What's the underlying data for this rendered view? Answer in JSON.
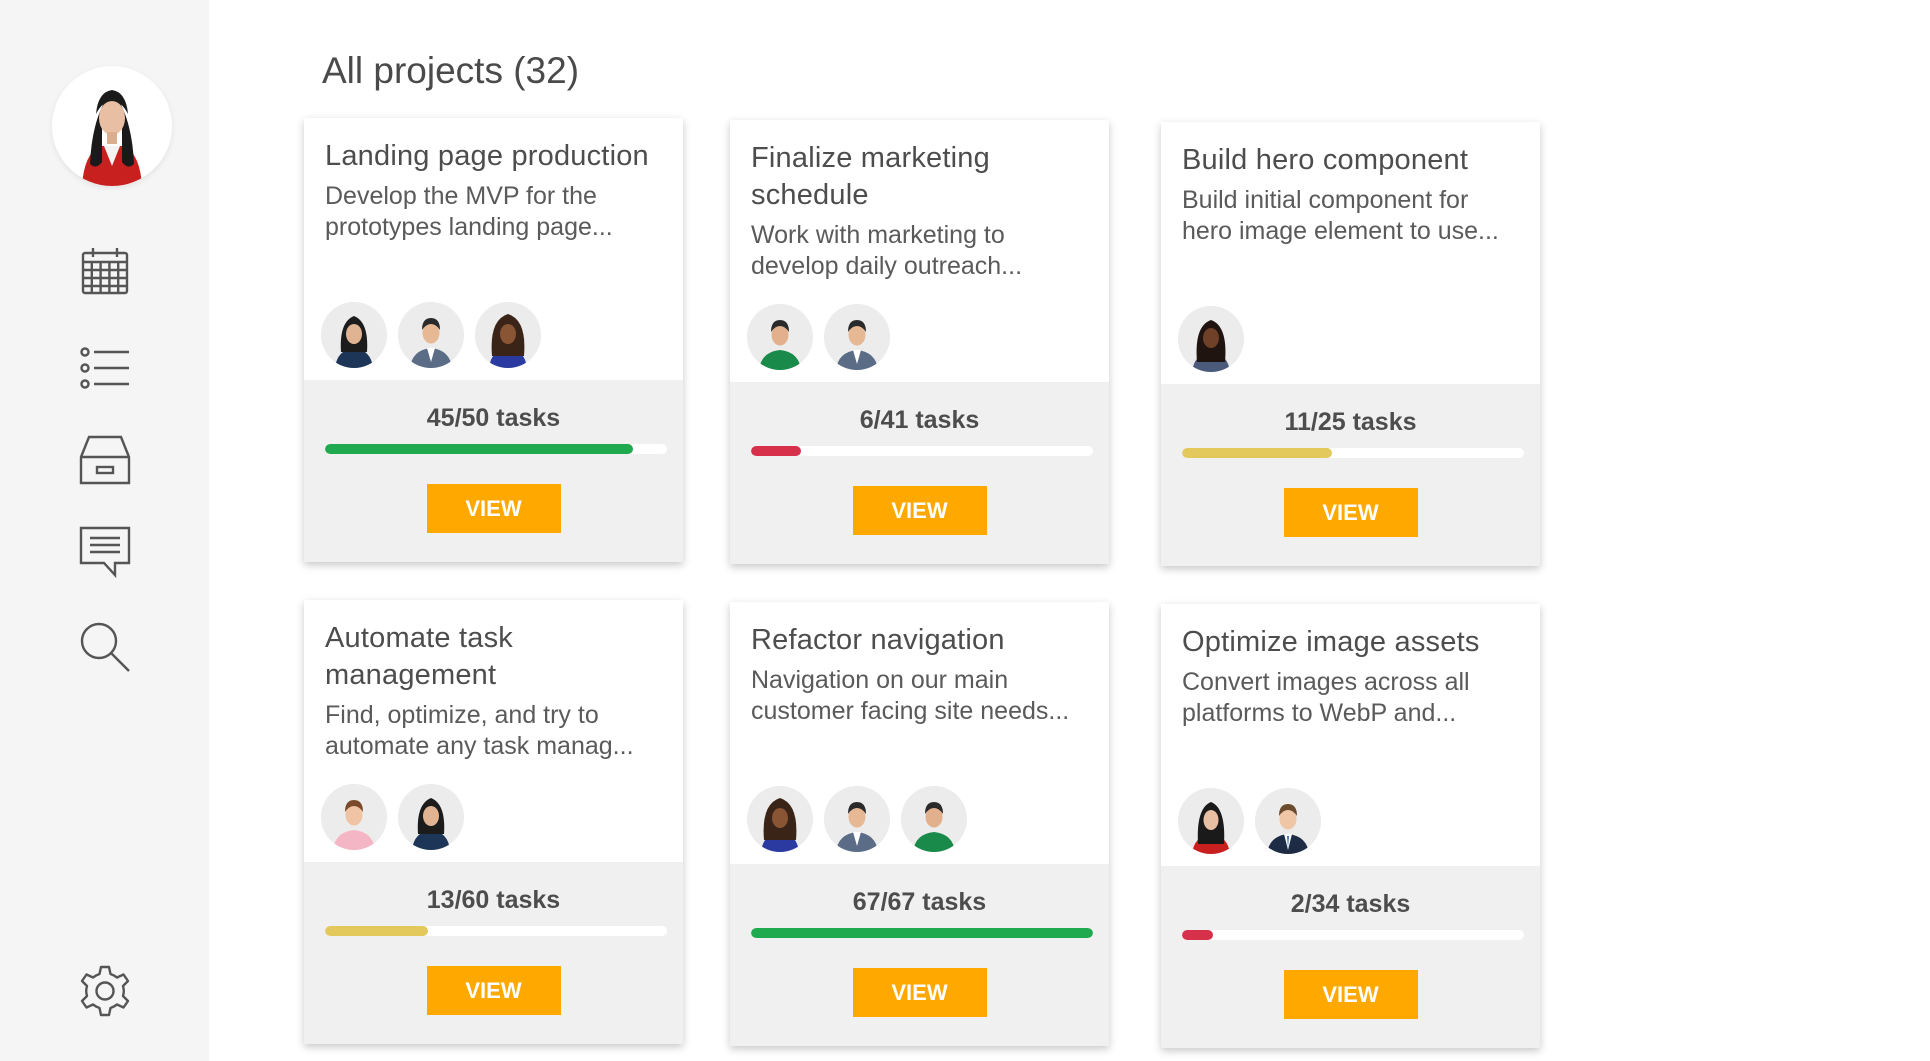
{
  "page": {
    "title": "All projects (32)"
  },
  "sidebar": {
    "profile": "user-avatar",
    "nav": [
      {
        "icon": "calendar-icon"
      },
      {
        "icon": "list-icon"
      },
      {
        "icon": "inbox-icon"
      },
      {
        "icon": "message-icon"
      },
      {
        "icon": "search-icon"
      },
      {
        "icon": "gear-icon"
      }
    ]
  },
  "colors": {
    "accent": "#ffa800",
    "progress_green": "#1faa4f",
    "progress_red": "#d6304a",
    "progress_yellow": "#e3c85c"
  },
  "projects": [
    {
      "title": "Landing page production",
      "description": "Develop the MVP for the prototypes landing page...",
      "tasks_label": "45/50 tasks",
      "progress": 0.9,
      "status_color": "#1faa4f",
      "members": [
        "woman-dark-hair",
        "man-gray-suit",
        "woman-curly-hair"
      ],
      "button_label": "VIEW"
    },
    {
      "title": "Finalize marketing schedule",
      "description": "Work with marketing to develop daily outreach...",
      "tasks_label": "6/41 tasks",
      "progress": 0.146,
      "status_color": "#d6304a",
      "members": [
        "man-green-shirt",
        "man-gray-suit"
      ],
      "button_label": "VIEW"
    },
    {
      "title": "Build hero component",
      "description": "Build initial component for hero image element to use...",
      "tasks_label": "11/25 tasks",
      "progress": 0.44,
      "status_color": "#e3c85c",
      "members": [
        "woman-dark-skin"
      ],
      "button_label": "VIEW"
    },
    {
      "title": "Automate task management",
      "description": "Find, optimize, and try to automate any task manag...",
      "tasks_label": "13/60 tasks",
      "progress": 0.3,
      "status_color": "#e3c85c",
      "members": [
        "man-pink-shirt",
        "woman-dark-hair"
      ],
      "button_label": "VIEW"
    },
    {
      "title": "Refactor navigation",
      "description": "Navigation on our main customer facing site needs...",
      "tasks_label": "67/67 tasks",
      "progress": 1.0,
      "status_color": "#1faa4f",
      "members": [
        "woman-curly-hair",
        "man-gray-suit",
        "man-green-shirt"
      ],
      "button_label": "VIEW"
    },
    {
      "title": "Optimize image assets",
      "description": "Convert images across all platforms to WebP and...",
      "tasks_label": "2/34 tasks",
      "progress": 0.09,
      "status_color": "#d6304a",
      "members": [
        "woman-red-jacket",
        "man-business-suit"
      ],
      "button_label": "VIEW"
    }
  ]
}
